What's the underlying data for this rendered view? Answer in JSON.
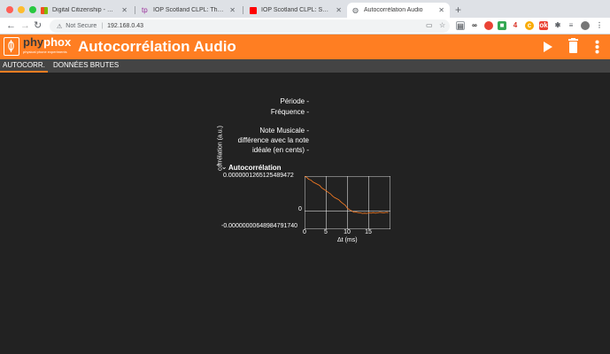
{
  "browser": {
    "tabs": [
      {
        "title": "Digital Citizenship - Microsoft",
        "favicon_color": "#f25022"
      },
      {
        "title": "IOP Scotland CLPL: The Solar",
        "favicon_color": "#9b2f9b"
      },
      {
        "title": "IOP Scotland CLPL: Smartphone",
        "favicon_color": "#ff0000"
      },
      {
        "title": "Autocorrélation Audio",
        "favicon_color": "#5f6368"
      }
    ],
    "not_secure": "Not Secure",
    "url": "192.168.0.43"
  },
  "app": {
    "logo_phy": "phy",
    "logo_phox": "phox",
    "logo_tagline": "physical phone experiments",
    "title": "Autocorrélation Audio"
  },
  "views": {
    "tab_autocorr": "AUTOCORR.",
    "tab_raw": "DONNÉES BRUTES"
  },
  "values": {
    "periode": "Période",
    "periode_val": "-",
    "frequence": "Fréquence",
    "frequence_val": "-",
    "note": "Note Musicale",
    "note_val": "-",
    "diff_line1": "différence avec la note",
    "diff_line2": "idéale (en cents)",
    "diff_val": "-"
  },
  "chart_data": {
    "type": "line",
    "title": "Autocorrélation",
    "xlabel": "Δt (ms)",
    "ylabel": "corrélation (a.u.)",
    "xlim": [
      0,
      20
    ],
    "ylim": [
      -6.4898479174e-08,
      1.26512548947e-07
    ],
    "xticks": [
      "0",
      "5",
      "10",
      "15"
    ],
    "yticks": [
      "0.0000001265125489472",
      "0",
      "-0.00000000648984791740"
    ],
    "grid": true,
    "series_color": "#ff7e22",
    "x": [
      0,
      0.5,
      1,
      1.5,
      2,
      2.5,
      3,
      3.5,
      4,
      4.5,
      5,
      5.5,
      6,
      6.5,
      7,
      7.5,
      8,
      8.5,
      9,
      9.5,
      10,
      10.5,
      11,
      11.5,
      12,
      12.5,
      13,
      13.5,
      14,
      14.5,
      15,
      15.5,
      16,
      16.5,
      17,
      17.5,
      18,
      18.5,
      19,
      19.5
    ],
    "y": [
      126.5,
      122,
      115,
      112,
      105,
      101,
      97,
      93,
      84,
      79,
      74,
      68,
      63,
      55,
      49,
      45,
      41,
      33,
      27,
      21,
      10,
      5,
      1,
      -4,
      -3,
      -5,
      -6,
      -8,
      -7,
      -8,
      -6,
      -7,
      -5,
      -7,
      -6,
      -4,
      -5,
      -6,
      -4,
      -5
    ]
  }
}
